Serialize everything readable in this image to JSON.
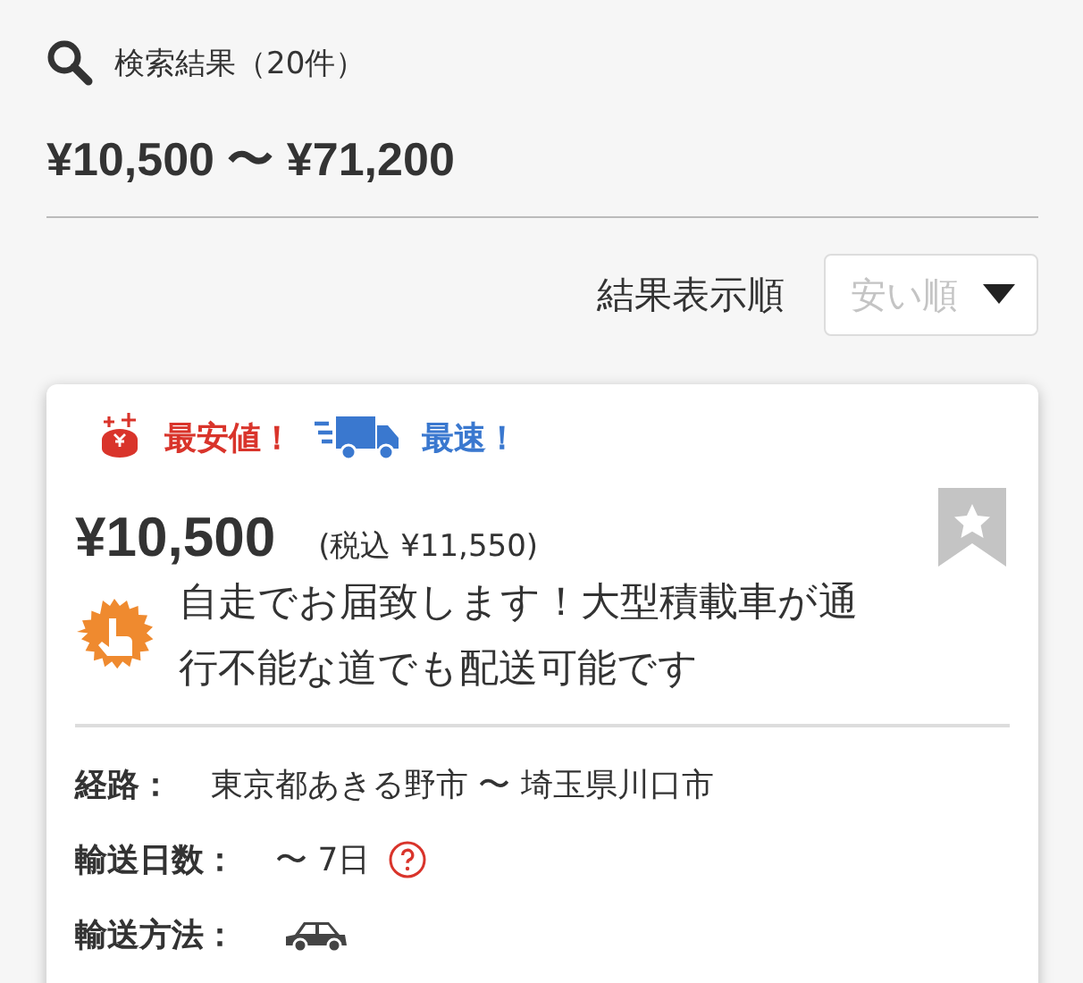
{
  "search_header": {
    "label": "検索結果（20件）"
  },
  "price_range": "¥10,500 〜 ¥71,200",
  "sort": {
    "label": "結果表示順",
    "placeholder": "安い順"
  },
  "result": {
    "badges": [
      {
        "kind": "cheapest",
        "label": "最安値！",
        "color": "#d9342b"
      },
      {
        "kind": "fastest",
        "label": "最速！",
        "color": "#3a78cf"
      }
    ],
    "price": "¥10,500",
    "tax_price": "(税込 ¥11,550)",
    "bookmarked": false,
    "note": "自走でお届致します！大型積載車が通行不能な道でも配送可能です",
    "details": [
      {
        "kind": "text",
        "label": "経路：",
        "value": "東京都あきる野市 〜 埼玉県川口市"
      },
      {
        "kind": "days",
        "label": "輸送日数：",
        "value": "〜 7日"
      },
      {
        "kind": "vehicle",
        "label": "輸送方法："
      }
    ]
  }
}
